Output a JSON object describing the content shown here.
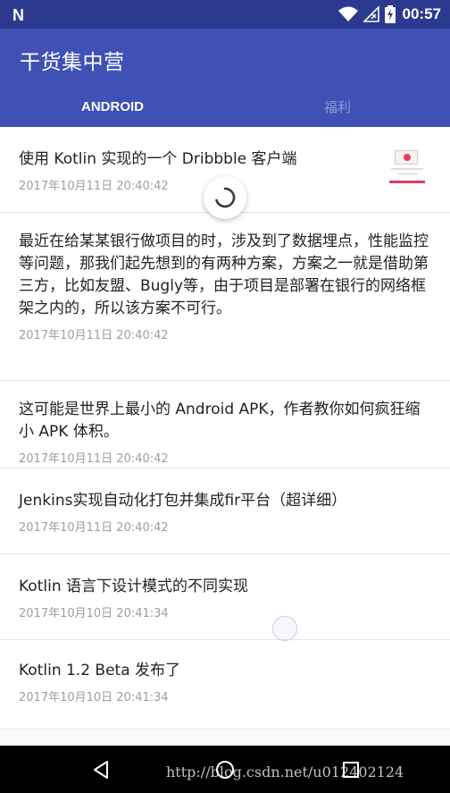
{
  "status_bar": {
    "time": "00:57",
    "icons": [
      "notification-n-icon",
      "wifi-icon",
      "signal-icon",
      "battery-charging-icon"
    ]
  },
  "app_bar": {
    "title": "干货集中营",
    "tabs": [
      {
        "label": "ANDROID",
        "active": true
      },
      {
        "label": "福利",
        "active": false
      }
    ]
  },
  "articles": [
    {
      "title": "使用 Kotlin 实现的一个 Dribbble 客户端",
      "time": "2017年10月11日 20:40:42",
      "has_thumbnail": true
    },
    {
      "title": "最近在给某某银行做项目的时，涉及到了数据埋点，性能监控等问题，那我们起先想到的有两种方案，方案之一就是借助第三方，比如友盟、Bugly等，由于项目是部署在银行的网络框架之内的，所以该方案不可行。",
      "time": "2017年10月11日 20:40:42"
    },
    {
      "title": "这可能是世界上最小的 Android APK，作者教你如何疯狂缩小 APK 体积。",
      "time": "2017年10月11日 20:40:42"
    },
    {
      "title": "Jenkins实现自动化打包并集成fir平台（超详细）",
      "time": "2017年10月11日 20:40:42"
    },
    {
      "title": "Kotlin 语言下设计模式的不同实现",
      "time": "2017年10月10日 20:41:34"
    },
    {
      "title": "Kotlin 1.2 Beta 发布了",
      "time": "2017年10月10日 20:41:34"
    }
  ],
  "nav_bar": {
    "watermark": "http://blog.csdn.net/u012402124"
  },
  "colors": {
    "primary": "#3f51b5",
    "primary_dark": "#2b3a8f",
    "text_primary": "#222222",
    "text_secondary": "#9e9e9e"
  }
}
